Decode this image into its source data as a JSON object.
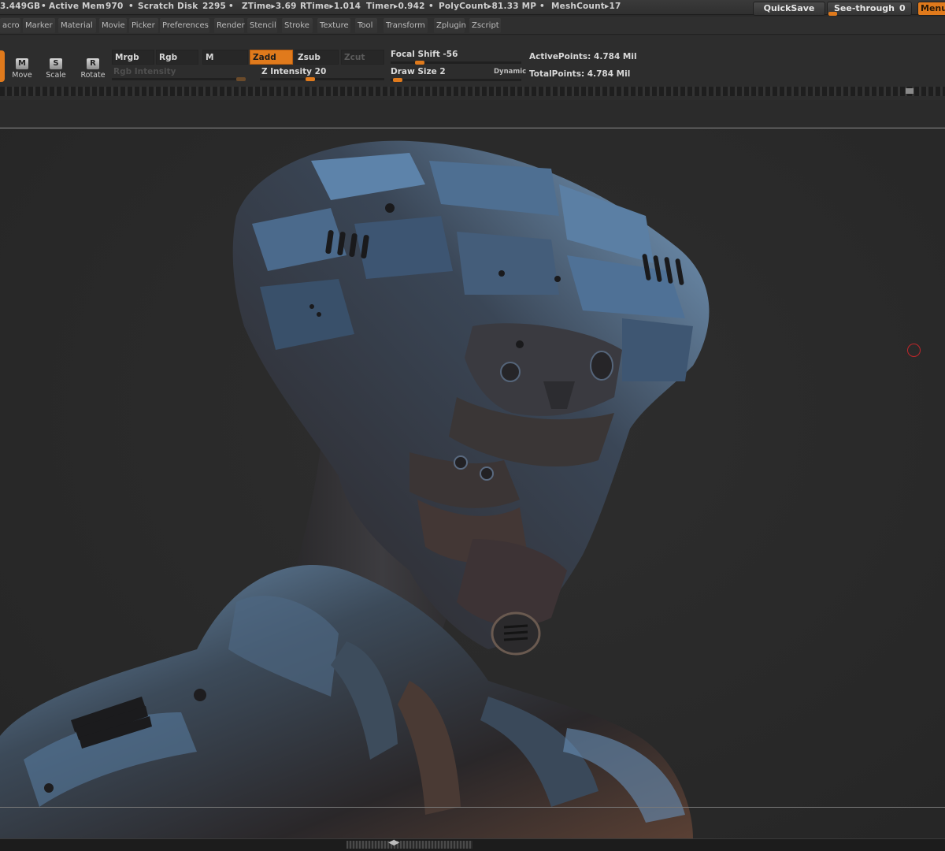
{
  "status": {
    "free_mem": "3.449GB",
    "active_mem_label": "Active Mem",
    "active_mem_value": "970",
    "scratch_label": "Scratch Disk",
    "scratch_value": "2295",
    "ztime": "ZTime▸3.69",
    "rtime": "RTime▸1.014",
    "timer": "Timer▸0.942",
    "polycount": "PolyCount▸81.33 MP",
    "meshcount": "MeshCount▸17"
  },
  "top_buttons": {
    "quicksave": "QuickSave",
    "see_through_label": "See-through",
    "see_through_value": "0",
    "see_through_level": 0.0,
    "menus": "Menus"
  },
  "menus": [
    "acro",
    "Marker",
    "Material",
    "Movie",
    "Picker",
    "Preferences",
    "Render",
    "Stencil",
    "Stroke",
    "Texture",
    "Tool",
    "Transform",
    "Zplugin",
    "Zscript"
  ],
  "shelf": {
    "move_glyph": "M",
    "move_label": "Move",
    "scale_glyph": "S",
    "scale_label": "Scale",
    "rotate_glyph": "R",
    "rotate_label": "Rotate",
    "mrgb": "Mrgb",
    "rgb": "Rgb",
    "m": "M",
    "zadd": "Zadd",
    "zsub": "Zsub",
    "zcut": "Zcut",
    "rgb_intensity": "Rgb Intensity",
    "z_intensity_label": "Z Intensity",
    "z_intensity_value": "20",
    "focal_shift_label": "Focal Shift",
    "focal_shift_value": "-56",
    "draw_size_label": "Draw Size",
    "draw_size_value": "2",
    "dynamic": "Dynamic",
    "active_points": "ActivePoints: 4.784 Mil",
    "total_points": "TotalPoints: 4.784 Mil"
  },
  "colors": {
    "accent": "#e07a1c",
    "cursor": "#c0262a",
    "armor_light": "#5b83a8",
    "armor_dark": "#2b2a2c",
    "armor_warm": "#6a4a3a"
  }
}
